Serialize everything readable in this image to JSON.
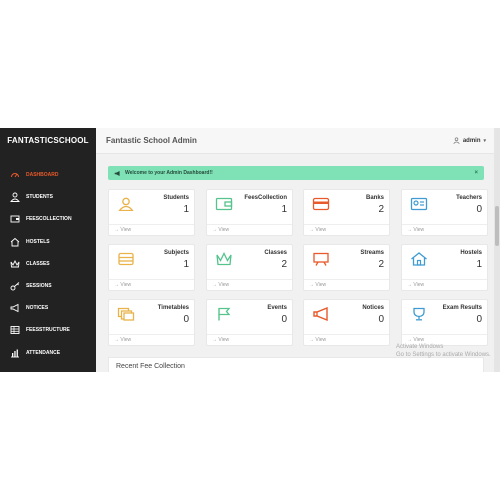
{
  "sidebar": {
    "brand": "FANTASTICSCHOOL",
    "items": [
      {
        "label": "DASHBOARD",
        "icon": "dashboard-icon"
      },
      {
        "label": "STUDENTS",
        "icon": "user-icon"
      },
      {
        "label": "FEESCOLLECTION",
        "icon": "wallet-icon"
      },
      {
        "label": "HOSTELS",
        "icon": "home-icon"
      },
      {
        "label": "CLASSES",
        "icon": "crown-icon"
      },
      {
        "label": "SESSIONS",
        "icon": "key-icon"
      },
      {
        "label": "NOTICES",
        "icon": "megaphone-icon"
      },
      {
        "label": "FEESSTRUCTURE",
        "icon": "table-icon"
      },
      {
        "label": "ATTENDANCE",
        "icon": "chart-icon"
      }
    ]
  },
  "header": {
    "title": "Fantastic School Admin",
    "user": "admin"
  },
  "alert": {
    "text": "Welcome to your Admin Dashboard!!",
    "close": "×"
  },
  "cards": [
    {
      "title": "Students",
      "count": "1",
      "view": "View",
      "color": "#e9b24a"
    },
    {
      "title": "FeesCollection",
      "count": "1",
      "view": "View",
      "color": "#54c48c"
    },
    {
      "title": "Banks",
      "count": "2",
      "view": "View",
      "color": "#e8592b"
    },
    {
      "title": "Teachers",
      "count": "0",
      "view": "View",
      "color": "#3f9bd2"
    },
    {
      "title": "Subjects",
      "count": "1",
      "view": "View",
      "color": "#e9b24a"
    },
    {
      "title": "Classes",
      "count": "2",
      "view": "View",
      "color": "#54c48c"
    },
    {
      "title": "Streams",
      "count": "2",
      "view": "View",
      "color": "#e8592b"
    },
    {
      "title": "Hostels",
      "count": "1",
      "view": "View",
      "color": "#3f9bd2"
    },
    {
      "title": "Timetables",
      "count": "0",
      "view": "View",
      "color": "#e9b24a"
    },
    {
      "title": "Events",
      "count": "0",
      "view": "View",
      "color": "#54c48c"
    },
    {
      "title": "Notices",
      "count": "0",
      "view": "View",
      "color": "#e8592b"
    },
    {
      "title": "Exam Results",
      "count": "0",
      "view": "View",
      "color": "#3f9bd2"
    }
  ],
  "recent": {
    "title": "Recent Fee Collection"
  },
  "watermark": {
    "line1": "Activate Windows",
    "line2": "Go to Settings to activate Windows."
  }
}
